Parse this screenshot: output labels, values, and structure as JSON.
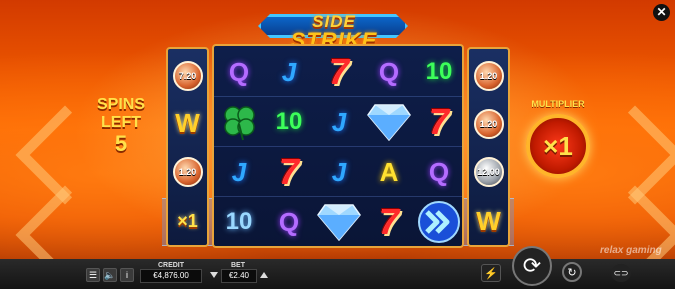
{
  "logo": {
    "line1": "SIDE",
    "line2": "STRIKE"
  },
  "close_icon": "close-icon",
  "spins_left": {
    "line1": "SPINS",
    "line2": "LEFT",
    "count": "5"
  },
  "multiplier": {
    "label": "MULTIPLIER",
    "value": "×1"
  },
  "left_column": [
    "7.20",
    "W",
    "1.20",
    "×1"
  ],
  "right_column": [
    "1.20",
    "1.20",
    "12.00",
    "W"
  ],
  "grid": [
    [
      "Q",
      "J",
      "7",
      "Q",
      "10"
    ],
    [
      "clover",
      "10",
      "J",
      "diamond",
      "7"
    ],
    [
      "J",
      "7",
      "J",
      "A",
      "Q"
    ],
    [
      "10",
      "Q",
      "diamond",
      "7",
      "chevrons"
    ]
  ],
  "brand": "relax gaming",
  "bottom_bar": {
    "credit_label": "CREDIT",
    "credit_value": "€4,876.00",
    "bet_label": "BET",
    "bet_value": "€2.40"
  },
  "colors": {
    "frame": "#e8a43a",
    "accent": "#ffe14a",
    "grid_bg": "#0e1e4a"
  }
}
